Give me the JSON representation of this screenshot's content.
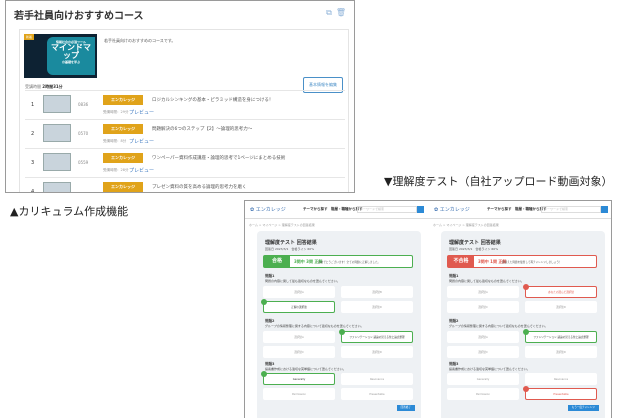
{
  "curriculum": {
    "title": "若手社員向けおすすめコース",
    "description": "若手社員向けのおすすめのコースです。",
    "new_badge": "新着",
    "thumbnail_text": {
      "top": "情報社会の必須ツール",
      "main": "マインドマップ",
      "bottom": "の基礎を学ぶ"
    },
    "study_time_label": "受講時間",
    "study_time": "2時間31分",
    "edit_button": "基本情報を編集",
    "items": [
      {
        "num": "1",
        "code": "0836",
        "tag": "エンカレッジ",
        "title": "ロジカルシンキングの基本・ピラミッド構造を身につける！",
        "duration": "受講時間：29分",
        "preview": "プレビュー"
      },
      {
        "num": "2",
        "code": "0570",
        "tag": "エンカレッジ",
        "title": "問題解決の6つのステップ【2】～論理的思考力～",
        "duration": "受講時間：8分",
        "preview": "プレビュー"
      },
      {
        "num": "3",
        "code": "0559",
        "tag": "エンカレッジ",
        "title": "ワンペーパー資料作成講座・論理的思考で1ページにまとめる技術",
        "duration": "受講時間：28分",
        "preview": "プレビュー"
      },
      {
        "num": "4",
        "code": "",
        "tag": "エンカレッジ",
        "title": "プレゼン資料の質を高める論理的思考力を磨く",
        "duration": "",
        "preview": ""
      }
    ]
  },
  "captions": {
    "curriculum": "▲カリキュラム作成機能",
    "test": "▼理解度テスト（自社アップロード動画対象）"
  },
  "test_panels": [
    {
      "logo": "エンカレッジ",
      "nav": "テーマから探す　階層・職種から探す",
      "search": "キーワードで検索",
      "breadcrumb": "ホーム > マイページ > 理解度テストの回答結果",
      "title": "理解度テスト 回答結果",
      "subtitle": "回答日 2023/3/1　合格ライン 60%",
      "result": "合格",
      "score": "3問中 3問 正解",
      "message": "おめでとうございます！全ての問題に正解しました。",
      "q1": "問題1",
      "q1_text": "問題の内容に関して最も適切なものを選んでください。",
      "q1_opts": [
        "選択肢A",
        "選択肢B",
        "正解の選択肢",
        "選択肢D"
      ],
      "q2": "問題2",
      "q2_text": "グループの情報整理に関する内容について適切なものを選んでください。",
      "q2_opts": [
        "選択肢A",
        "ファシリテーション 議論の見える化と論点整理",
        "選択肢C",
        "選択肢D"
      ],
      "q3": "問題3",
      "q3_text": "提案書作成における適切な英単語について選んでください。",
      "q3_opts": [
        "Generally",
        "Resonance",
        "Permission",
        "Presentable"
      ],
      "button": "回答終了",
      "colors": {
        "accent": "#4caf50"
      }
    },
    {
      "logo": "エンカレッジ",
      "nav": "テーマから探す　階層・職種から探す",
      "search": "キーワードで検索",
      "breadcrumb": "ホーム > マイページ > 理解度テストの回答結果",
      "title": "理解度テスト 回答結果",
      "subtitle": "回答日 2023/3/1　合格ライン 60%",
      "result": "不合格",
      "score": "3問中 1問 正解",
      "message": "間違えた問題を復習して再チャレンジしましょう！",
      "q1": "問題1",
      "q1_text": "問題の内容に関して最も適切なものを選んでください。",
      "q1_opts": [
        "選択肢A",
        "あなたの選んだ選択肢",
        "選択肢C",
        "選択肢D"
      ],
      "q2": "問題2",
      "q2_text": "グループの情報整理に関する内容について適切なものを選んでください。",
      "q2_opts": [
        "選択肢A",
        "ファシリテーション 議論の見える化と論点整理",
        "選択肢C",
        "選択肢D"
      ],
      "q3": "問題3",
      "q3_text": "提案書作成における適切な英単語について選んでください。",
      "q3_opts": [
        "Generally",
        "Resonance",
        "Permission",
        "Presentable"
      ],
      "button": "もう一度チャレンジ",
      "colors": {
        "accent": "#e05a4f"
      }
    }
  ]
}
